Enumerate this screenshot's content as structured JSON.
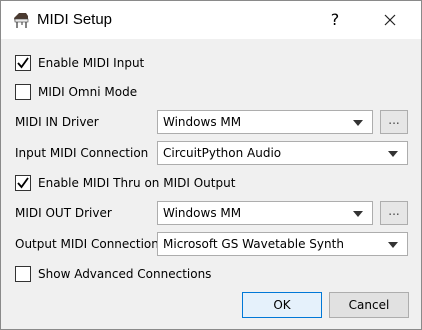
{
  "window": {
    "title": "MIDI Setup",
    "help_label": "?"
  },
  "options": {
    "enable_midi_input": {
      "label": "Enable MIDI Input",
      "checked": true
    },
    "midi_omni_mode": {
      "label": "MIDI Omni Mode",
      "checked": false
    },
    "enable_midi_thru": {
      "label": "Enable MIDI Thru on MIDI Output",
      "checked": true
    },
    "show_advanced": {
      "label": "Show Advanced Connections",
      "checked": false
    }
  },
  "fields": {
    "midi_in_driver": {
      "label": "MIDI IN Driver",
      "value": "Windows MM",
      "browse_label": "..."
    },
    "input_midi_connection": {
      "label": "Input MIDI Connection",
      "value": "CircuitPython Audio"
    },
    "midi_out_driver": {
      "label": "MIDI OUT Driver",
      "value": "Windows MM",
      "browse_label": "..."
    },
    "output_midi_connection": {
      "label": "Output MIDI Connection",
      "value": "Microsoft GS Wavetable Synth"
    }
  },
  "buttons": {
    "ok": "OK",
    "cancel": "Cancel"
  },
  "icons": {
    "app": "piano-icon",
    "help": "help-icon",
    "close": "close-icon",
    "check": "checkmark-icon",
    "dropdown": "chevron-down-icon"
  }
}
